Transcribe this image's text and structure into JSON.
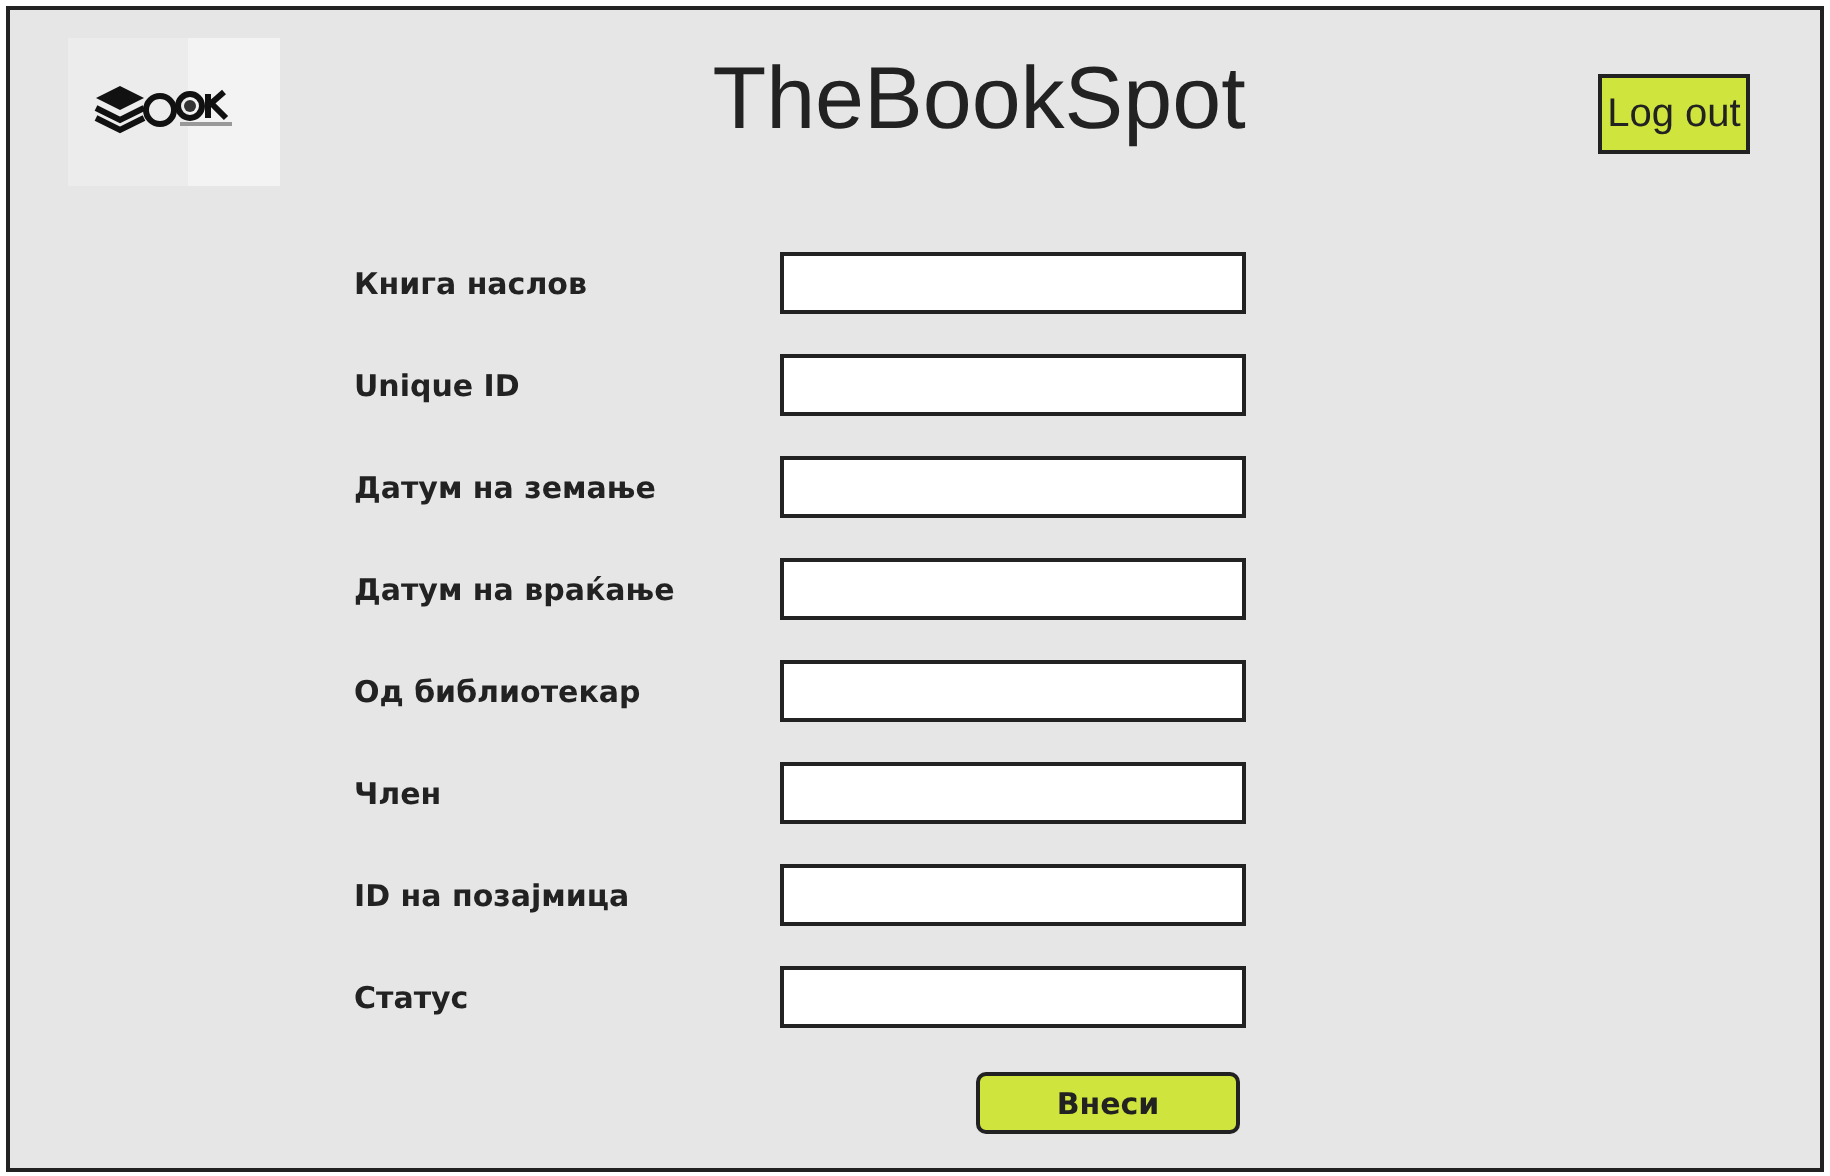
{
  "header": {
    "title": "TheBookSpot",
    "logout_button": "Log out"
  },
  "form": {
    "fields": [
      {
        "label": "Книга наслов"
      },
      {
        "label": "Unique ID"
      },
      {
        "label": "Датум на земање"
      },
      {
        "label": "Датум на враќање"
      },
      {
        "label": "Од библиотекар"
      },
      {
        "label": "Член"
      },
      {
        "label": "ID на позајмица"
      },
      {
        "label": "Статус"
      }
    ],
    "submit_button": "Внеси"
  }
}
